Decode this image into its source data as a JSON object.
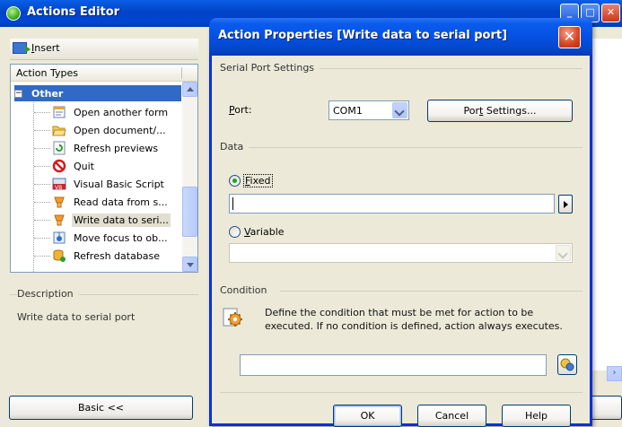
{
  "back_window": {
    "title": "Actions Editor",
    "toolbar": {
      "insert_label": "Insert",
      "insert_hotkey": "I",
      "insert_rest": "nsert"
    },
    "tree": {
      "column_header": "Action Types",
      "root": {
        "label": "Other",
        "expander": "−"
      },
      "items": [
        {
          "label": "Open another form",
          "icon": "form-icon"
        },
        {
          "label": "Open document/...",
          "icon": "folder-open-icon"
        },
        {
          "label": "Refresh previews",
          "icon": "refresh-previews-icon"
        },
        {
          "label": "Quit",
          "icon": "quit-icon"
        },
        {
          "label": "Visual Basic Script",
          "icon": "vb-script-icon"
        },
        {
          "label": "Read data from s...",
          "icon": "serial-read-icon"
        },
        {
          "label": "Write data to seri...",
          "icon": "serial-write-icon"
        },
        {
          "label": "Move focus to ob...",
          "icon": "move-focus-icon"
        },
        {
          "label": "Refresh database",
          "icon": "refresh-database-icon"
        }
      ]
    },
    "description": {
      "label": "Description",
      "text": "Write data to serial port"
    },
    "basic_button": "Basic <<"
  },
  "dialog": {
    "title": "Action Properties [Write data to serial port]",
    "close_glyph": "✕",
    "serial_group": {
      "label": "Serial Port Settings",
      "port_label_hotkey": "P",
      "port_label_rest": "ort:",
      "port_value": "COM1",
      "port_settings_button_pre": "Por",
      "port_settings_button_hotkey": "t",
      "port_settings_button_post": " Settings..."
    },
    "data_group": {
      "label": "Data",
      "fixed_hotkey": "F",
      "fixed_rest": "ixed",
      "fixed_selected": true,
      "fixed_value": "",
      "variable_hotkey": "V",
      "variable_rest": "ariable",
      "variable_value": ""
    },
    "condition_group": {
      "label": "Condition",
      "description": "Define the condition that must be met for action to be executed. If no condition is defined, action always executes.",
      "value": ""
    },
    "buttons": {
      "ok": "OK",
      "cancel": "Cancel",
      "help": "Help"
    }
  },
  "colors": {
    "title_blue": "#0054e3",
    "face": "#ece9d8",
    "close_red": "#d7431f",
    "selection": "#316ac5"
  }
}
